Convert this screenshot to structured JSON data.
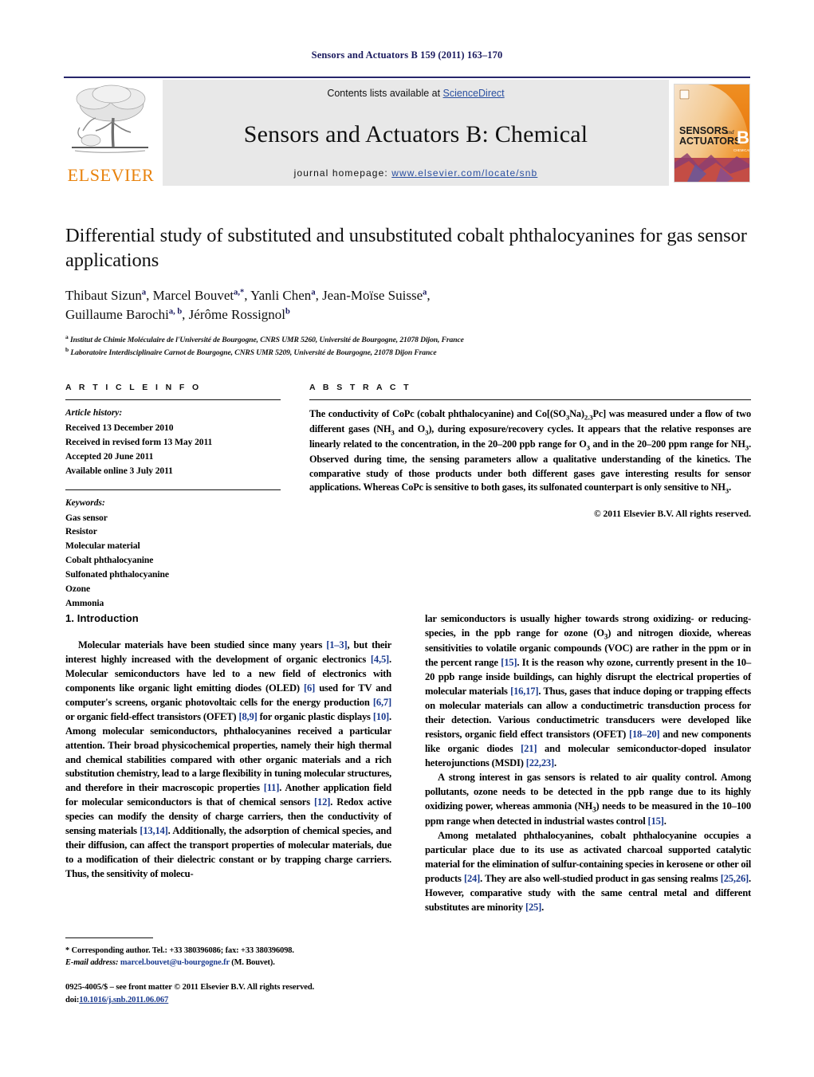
{
  "running_head": "Sensors and Actuators B 159 (2011) 163–170",
  "masthead": {
    "contents_prefix": "Contents lists available at ",
    "sciencedirect": "ScienceDirect",
    "journal_title": "Sensors and Actuators B: Chemical",
    "homepage_prefix": "journal homepage: ",
    "homepage_url": "www.elsevier.com/locate/snb",
    "publisher": "ELSEVIER",
    "cover_line1": "SENSORS",
    "cover_and": "and",
    "cover_line2": "ACTUATORS",
    "cover_letter": "B",
    "cover_sub": "CHEMICAL",
    "accent_orange": "#E8820C",
    "link_blue": "#2a4fa0"
  },
  "article": {
    "title": "Differential study of substituted and unsubstituted cobalt phthalocyanines for gas sensor applications",
    "authors_line1_html": "Thibaut Sizun<sup>a</sup>, Marcel Bouvet<sup>a,*</sup>, Yanli Chen<sup>a</sup>, Jean-Moïse Suisse<sup>a</sup>,",
    "authors_line2_html": "Guillaume Barochi<sup>a, b</sup>, Jérôme Rossignol<sup>b</sup>",
    "affiliation_a": "Institut de Chimie Moléculaire de l'Université de Bourgogne, CNRS UMR 5260, Université de Bourgogne, 21078 Dijon, France",
    "affiliation_b": "Laboratoire Interdisciplinaire Carnot de Bourgogne, CNRS UMR 5209, Université de Bourgogne, 21078 Dijon France"
  },
  "article_info": {
    "heading": "A R T I C L E    I N F O",
    "history_label": "Article history:",
    "history": [
      "Received 13 December 2010",
      "Received in revised form 13 May 2011",
      "Accepted 20 June 2011",
      "Available online 3 July 2011"
    ],
    "keywords_label": "Keywords:",
    "keywords": [
      "Gas sensor",
      "Resistor",
      "Molecular material",
      "Cobalt phthalocyanine",
      "Sulfonated phthalocyanine",
      "Ozone",
      "Ammonia"
    ]
  },
  "abstract": {
    "heading": "A B S T R A C T",
    "text_html": "The conductivity of CoPc (cobalt phthalocyanine) and Co[(SO<sub>3</sub>Na)<sub>2.3</sub>Pc] was measured under a flow of two different gases (NH<sub>3</sub> and O<sub>3</sub>), during exposure/recovery cycles. It appears that the relative responses are linearly related to the concentration, in the 20–200 ppb range for O<sub>3</sub> and in the 20–200 ppm range for NH<sub>3</sub>. Observed during time, the sensing parameters allow a qualitative understanding of the kinetics. The comparative study of those products under both different gases gave interesting results for sensor applications. Whereas CoPc is sensitive to both gases, its sulfonated counterpart is only sensitive to NH<sub>3</sub>.",
    "copyright": "© 2011 Elsevier B.V. All rights reserved."
  },
  "introduction": {
    "heading": "1.  Introduction",
    "left_paragraph_html": "Molecular materials have been studied since many years <span class=\"ref\">[1–3]</span>, but their interest highly increased with the development of organic electronics <span class=\"ref\">[4,5]</span>. Molecular semiconductors have led to a new field of electronics with components like organic light emitting diodes (OLED) <span class=\"ref\">[6]</span> used for TV and computer's screens, organic photovoltaic cells for the energy production <span class=\"ref\">[6,7]</span> or organic field-effect transistors (OFET) <span class=\"ref\">[8,9]</span> for organic plastic displays <span class=\"ref\">[10]</span>. Among molecular semiconductors, phthalocyanines received a particular attention. Their broad physicochemical properties, namely their high thermal and chemical stabilities compared with other organic materials and a rich substitution chemistry, lead to a large flexibility in tuning molecular structures, and therefore in their macroscopic properties <span class=\"ref\">[11]</span>. Another application field for molecular semiconductors is that of chemical sensors <span class=\"ref\">[12]</span>. Redox active species can modify the density of charge carriers, then the conductivity of sensing materials <span class=\"ref\">[13,14]</span>. Additionally, the adsorption of chemical species, and their diffusion, can affect the transport properties of molecular materials, due to a modification of their dielectric constant or by trapping charge carriers. Thus, the sensitivity of molecu-",
    "right_paragraph1_html": "lar semiconductors is usually higher towards strong oxidizing- or reducing-species, in the ppb range for ozone (O<sub>3</sub>) and nitrogen dioxide, whereas sensitivities to volatile organic compounds (VOC) are rather in the ppm or in the percent range <span class=\"ref\">[15]</span>. It is the reason why ozone, currently present in the 10–20 ppb range inside buildings, can highly disrupt the electrical properties of molecular materials <span class=\"ref\">[16,17]</span>. Thus, gases that induce doping or trapping effects on molecular materials can allow a conductimetric transduction process for their detection. Various conductimetric transducers were developed like resistors, organic field effect transistors (OFET) <span class=\"ref\">[18–20]</span> and new components like organic diodes <span class=\"ref\">[21]</span> and molecular semiconductor-doped insulator heterojunctions (MSDI) <span class=\"ref\">[22,23]</span>.",
    "right_paragraph2_html": "A strong interest in gas sensors is related to air quality control. Among pollutants, ozone needs to be detected in the ppb range due to its highly oxidizing power, whereas ammonia (NH<sub>3</sub>) needs to be measured in the 10–100 ppm range when detected in industrial wastes control <span class=\"ref\">[15]</span>.",
    "right_paragraph3_html": "Among metalated phthalocyanines, cobalt phthalocyanine occupies a particular place due to its use as activated charcoal supported catalytic material for the elimination of sulfur-containing species in kerosene or other oil products <span class=\"ref\">[24]</span>. They are also well-studied product in gas sensing realms <span class=\"ref\">[25,26]</span>. However, comparative study with the same central metal and different substitutes are minority <span class=\"ref\">[25]</span>."
  },
  "footnote": {
    "corresponding_html": "<b>*</b> Corresponding author. Tel.: +33 380396086; fax: +33 380396098.",
    "email_html": "<span class=\"ital\">E-mail address:</span> <span class=\"link\">marcel.bouvet@u-bourgogne.fr</span> (M. Bouvet)."
  },
  "footer": {
    "issn_line": "0925-4005/$ – see front matter © 2011 Elsevier B.V. All rights reserved.",
    "doi_prefix": "doi:",
    "doi": "10.1016/j.snb.2011.06.067"
  }
}
